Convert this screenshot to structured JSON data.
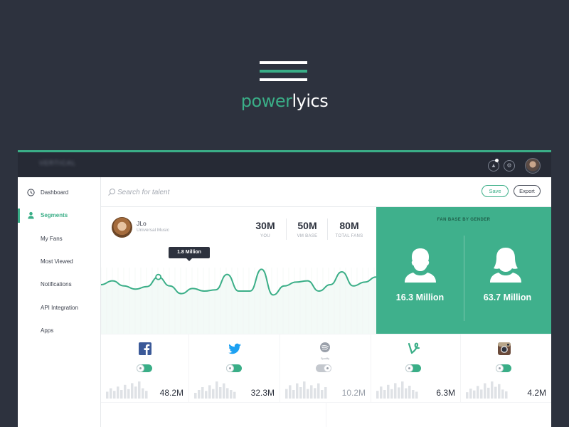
{
  "brand": {
    "name_part1": "power",
    "name_part2": "lyics"
  },
  "colors": {
    "accent": "#3aae87",
    "dark": "#2d323e",
    "fanbase_bg": "#3fb08c"
  },
  "topbar": {
    "logo_text": "VERTICAL"
  },
  "sidebar": {
    "items": [
      {
        "label": "Dashboard",
        "icon": "clock-icon"
      },
      {
        "label": "Segments",
        "icon": "person-icon",
        "active": true
      },
      {
        "label": "My Fans"
      },
      {
        "label": "Most Viewed"
      },
      {
        "label": "Notifications"
      },
      {
        "label": "API Integration"
      },
      {
        "label": "Apps"
      }
    ]
  },
  "search": {
    "placeholder": "Search for talent"
  },
  "buttons": {
    "save": "Save",
    "export": "Export"
  },
  "artist": {
    "name": "JLo",
    "label": "Universal Music"
  },
  "stats": [
    {
      "value": "30M",
      "caption": "YOU"
    },
    {
      "value": "50M",
      "caption": "VM BASE"
    },
    {
      "value": "80M",
      "caption": "TOTAL FANS"
    }
  ],
  "chart_data": {
    "type": "line",
    "tooltip": "1.8 Million",
    "highlight_index": 5,
    "y": [
      40,
      46,
      38,
      33,
      37,
      52,
      38,
      26,
      34,
      30,
      32,
      56,
      30,
      30,
      64,
      24,
      38,
      44,
      46,
      30,
      40,
      60,
      38,
      44,
      52
    ]
  },
  "fanbase": {
    "title": "FAN BASE BY GENDER",
    "male": {
      "value": "16.3 Million",
      "icon": "male-user-icon"
    },
    "female": {
      "value": "63.7 Million",
      "icon": "female-user-icon"
    }
  },
  "social": [
    {
      "name": "facebook",
      "icon": "facebook-icon",
      "value": "48.2M",
      "enabled": true,
      "spark": [
        8,
        12,
        9,
        14,
        10,
        16,
        11,
        18,
        14,
        20,
        12,
        9
      ]
    },
    {
      "name": "twitter",
      "icon": "twitter-icon",
      "value": "32.3M",
      "enabled": true,
      "spark": [
        6,
        9,
        12,
        8,
        14,
        10,
        18,
        12,
        16,
        11,
        9,
        7
      ]
    },
    {
      "name": "spotify",
      "icon": "spotify-icon",
      "icon_caption": "Spotify",
      "value": "10.2M",
      "enabled": false,
      "spark": [
        10,
        14,
        9,
        16,
        12,
        18,
        10,
        14,
        11,
        16,
        9,
        12
      ]
    },
    {
      "name": "vine",
      "icon": "vine-icon",
      "value": "6.3M",
      "enabled": true,
      "spark": [
        9,
        14,
        10,
        16,
        11,
        18,
        13,
        20,
        12,
        15,
        10,
        8
      ]
    },
    {
      "name": "instagram",
      "icon": "instagram-icon",
      "value": "4.2M",
      "enabled": true,
      "spark": [
        7,
        11,
        9,
        14,
        10,
        17,
        12,
        19,
        13,
        16,
        10,
        8
      ]
    }
  ]
}
